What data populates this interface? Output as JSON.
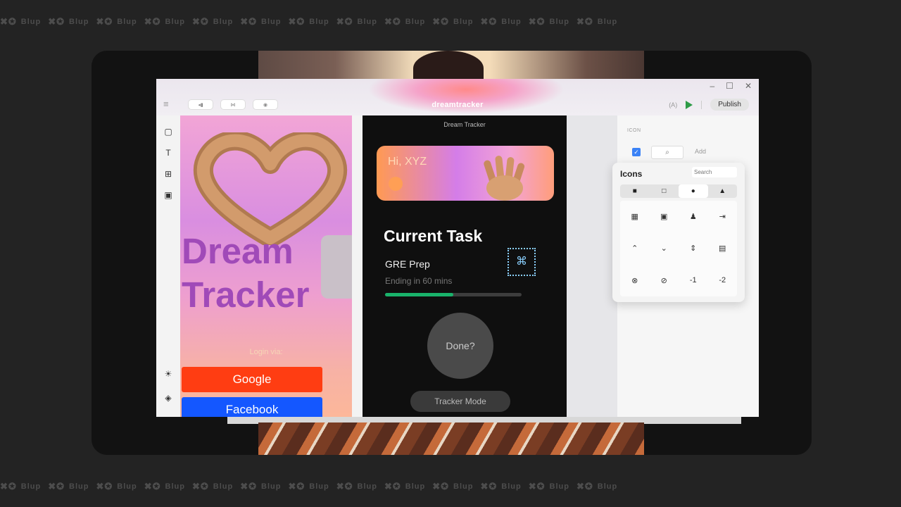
{
  "watermark": {
    "brand": "Blup",
    "mark": "✖✪"
  },
  "window": {
    "controls": [
      "–",
      "☐",
      "✕"
    ],
    "title": "dreamtracker",
    "toolbar_pills": [
      "◂▮",
      "⋈",
      "◉"
    ],
    "ai_label": "(A)",
    "publish_label": "Publish"
  },
  "screen1": {
    "headline": [
      "Dream",
      "Tracker"
    ],
    "login_label": "Login via:",
    "google_label": "Google",
    "facebook_label": "Facebook"
  },
  "screen2": {
    "title": "Dream Tracker",
    "greeting": "Hi, XYZ",
    "section_title": "Current Task",
    "task_name": "GRE Prep",
    "task_status": "Ending in 60 mins",
    "progress": 0.5,
    "done_label": "Done?",
    "mode_label": "Tracker Mode"
  },
  "right_panel": {
    "section_label": "ICON",
    "add_label": "Add"
  },
  "icons_popup": {
    "title": "Icons",
    "search_placeholder": "Search",
    "tabs": [
      "■",
      "□",
      "●",
      "▲"
    ],
    "icons": [
      "calendar-icon",
      "calendar-add-icon",
      "person-icon",
      "login-icon",
      "chevron-up-icon",
      "chevron-down-icon",
      "vertical-align-icon",
      "text-box-icon",
      "cancel-icon",
      "compass-icon",
      "minus-one-icon",
      "minus-two-icon"
    ],
    "icon_glyphs": [
      "▦",
      "▣",
      "♟",
      "⇥",
      "⌃",
      "⌄",
      "⇕",
      "▤",
      "⊗",
      "⊘",
      "-1",
      "-2"
    ]
  }
}
